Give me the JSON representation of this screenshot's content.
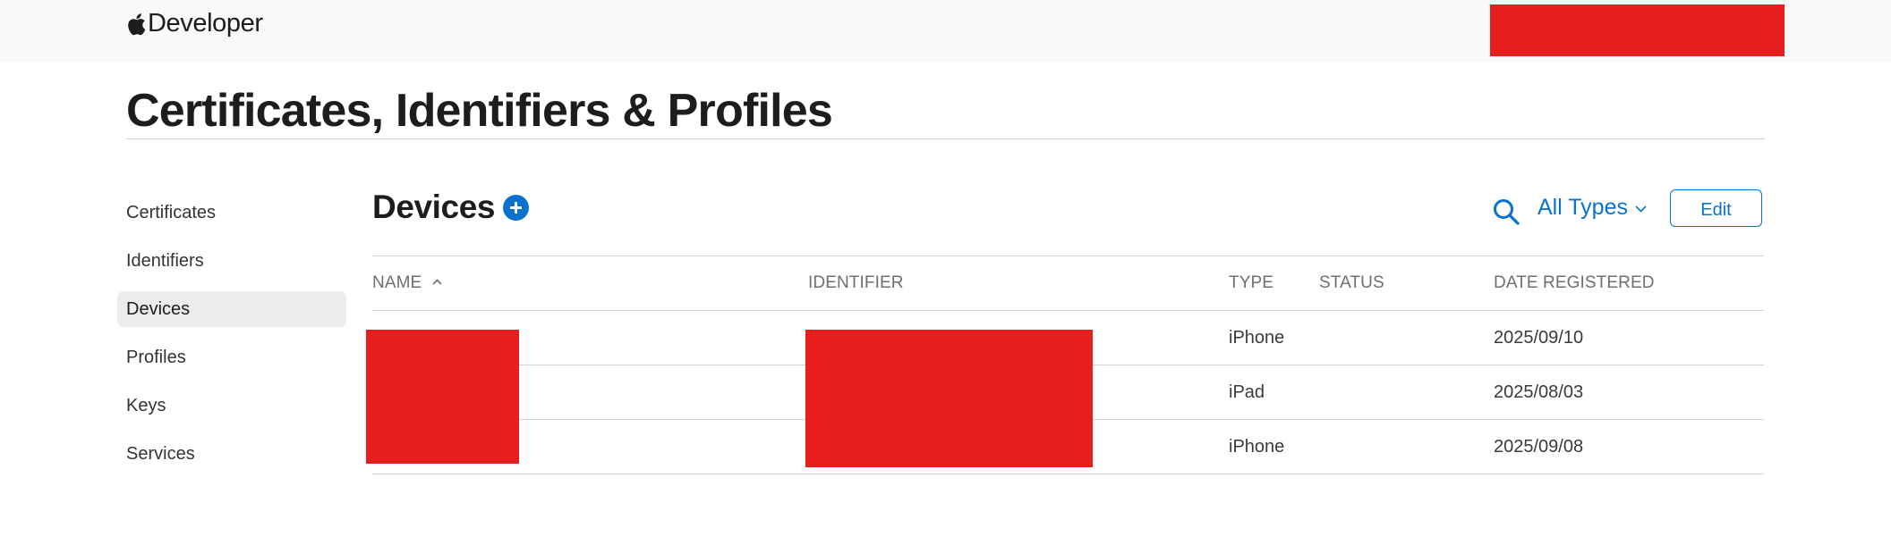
{
  "header": {
    "brand_label": "Developer"
  },
  "page": {
    "title": "Certificates, Identifiers & Profiles"
  },
  "sidebar": {
    "items": [
      {
        "label": "Certificates",
        "active": false
      },
      {
        "label": "Identifiers",
        "active": false
      },
      {
        "label": "Devices",
        "active": true
      },
      {
        "label": "Profiles",
        "active": false
      },
      {
        "label": "Keys",
        "active": false
      },
      {
        "label": "Services",
        "active": false
      }
    ]
  },
  "section": {
    "title": "Devices",
    "filter_label": "All Types",
    "edit_label": "Edit"
  },
  "table": {
    "columns": {
      "name": "NAME",
      "identifier": "IDENTIFIER",
      "type": "TYPE",
      "status": "STATUS",
      "date": "DATE REGISTERED"
    },
    "rows": [
      {
        "type": "iPhone",
        "status": "",
        "date": "2025/09/10"
      },
      {
        "type": "iPad",
        "status": "",
        "date": "2025/08/03"
      },
      {
        "type": "iPhone",
        "status": "",
        "date": "2025/09/08"
      }
    ]
  },
  "icons": {
    "brand": "apple-logo-icon",
    "add": "plus-circle-icon",
    "search": "search-icon",
    "filter": "chevron-down-icon",
    "sort": "chevron-up-icon"
  },
  "colors": {
    "accent": "#0a72cc",
    "redaction": "#e61e1e",
    "topbar": "#f9f9f9",
    "active_nav": "#ececec"
  }
}
